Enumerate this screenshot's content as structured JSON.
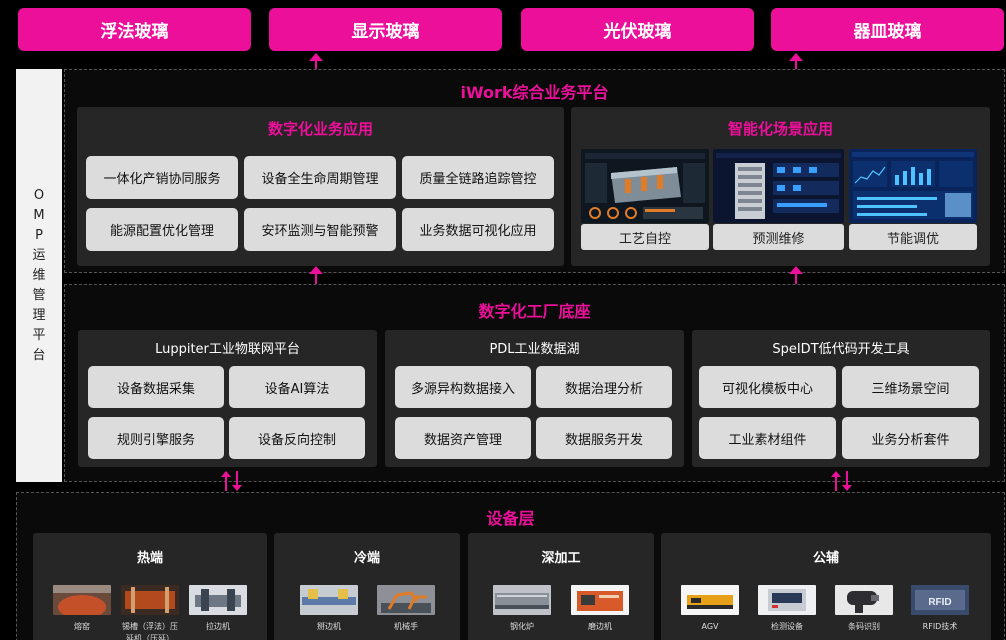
{
  "products": [
    "浮法玻璃",
    "显示玻璃",
    "光伏玻璃",
    "器皿玻璃"
  ],
  "omp": [
    "O",
    "M",
    "P",
    "运",
    "维",
    "管",
    "理",
    "平",
    "台"
  ],
  "iwork": {
    "title": "iWork综合业务平台",
    "digital": {
      "title": "数字化业务应用",
      "items": [
        "一体化产销协同服务",
        "设备全生命周期管理",
        "质量全链路追踪管控",
        "能源配置优化管理",
        "安环监测与智能预警",
        "业务数据可视化应用"
      ]
    },
    "smart": {
      "title": "智能化场景应用",
      "items": [
        "工艺自控",
        "预测维修",
        "节能调优"
      ]
    }
  },
  "factory": {
    "title": "数字化工厂底座",
    "panels": [
      {
        "title": "Luppiter工业物联网平台",
        "items": [
          "设备数据采集",
          "设备AI算法",
          "规则引擎服务",
          "设备反向控制"
        ]
      },
      {
        "title": "PDL工业数据湖",
        "items": [
          "多源异构数据接入",
          "数据治理分析",
          "数据资产管理",
          "数据服务开发"
        ]
      },
      {
        "title": "SpeIDT低代码开发工具",
        "items": [
          "可视化模板中心",
          "三维场景空间",
          "工业素材组件",
          "业务分析套件"
        ]
      }
    ]
  },
  "equipment": {
    "title": "设备层",
    "groups": [
      {
        "title": "热端",
        "items": [
          "熔窑",
          "锡槽（浮法）压延机（压延）",
          "拉边机"
        ]
      },
      {
        "title": "冷端",
        "items": [
          "掰边机",
          "机械手"
        ]
      },
      {
        "title": "深加工",
        "items": [
          "钢化炉",
          "磨边机"
        ]
      },
      {
        "title": "公辅",
        "items": [
          "AGV",
          "检测设备",
          "条码识别",
          "RFID技术"
        ]
      }
    ]
  },
  "colors": {
    "accent": "#ec0f9a",
    "tile": "#dcdcdc",
    "panel": "#262626",
    "background": "#000000"
  }
}
